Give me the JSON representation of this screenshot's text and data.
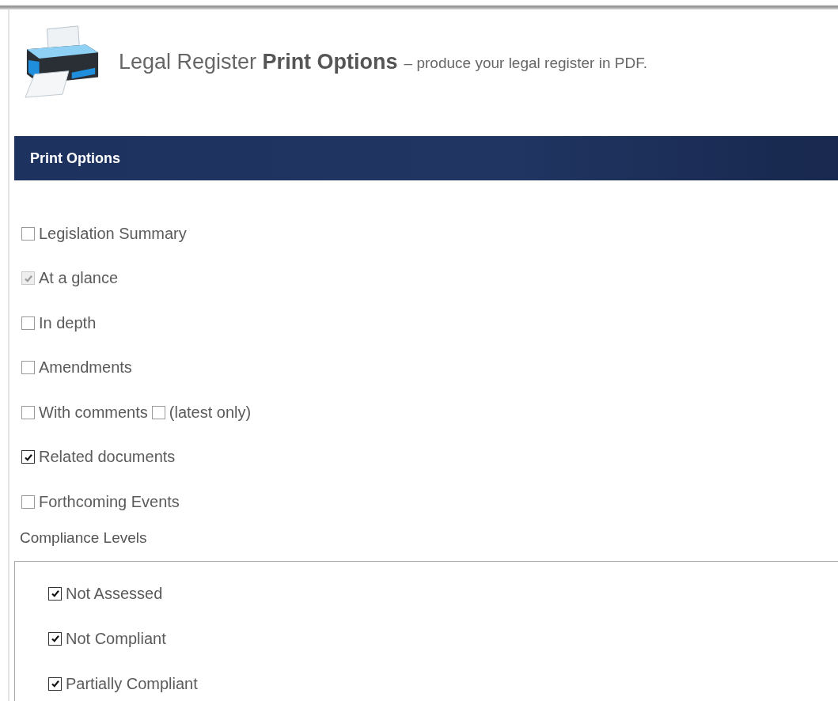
{
  "header": {
    "title_plain": "Legal Register ",
    "title_bold": "Print Options",
    "subtitle": "– produce your legal register in PDF."
  },
  "panel": {
    "title": "Print Options"
  },
  "options": [
    {
      "label": "Legislation Summary",
      "checked": false,
      "disabled": false
    },
    {
      "label": "At a glance",
      "checked": true,
      "disabled": true
    },
    {
      "label": "In depth",
      "checked": false,
      "disabled": false
    },
    {
      "label": "Amendments",
      "checked": false,
      "disabled": false
    },
    {
      "label": "With comments",
      "checked": false,
      "disabled": false,
      "sub": {
        "label": "(latest only)",
        "checked": false
      }
    },
    {
      "label": "Related documents",
      "checked": true,
      "disabled": false
    },
    {
      "label": "Forthcoming Events",
      "checked": false,
      "disabled": false
    }
  ],
  "compliance": {
    "label": "Compliance Levels",
    "levels": [
      {
        "label": "Not Assessed",
        "checked": true
      },
      {
        "label": "Not Compliant",
        "checked": true
      },
      {
        "label": "Partially Compliant",
        "checked": true
      }
    ]
  }
}
